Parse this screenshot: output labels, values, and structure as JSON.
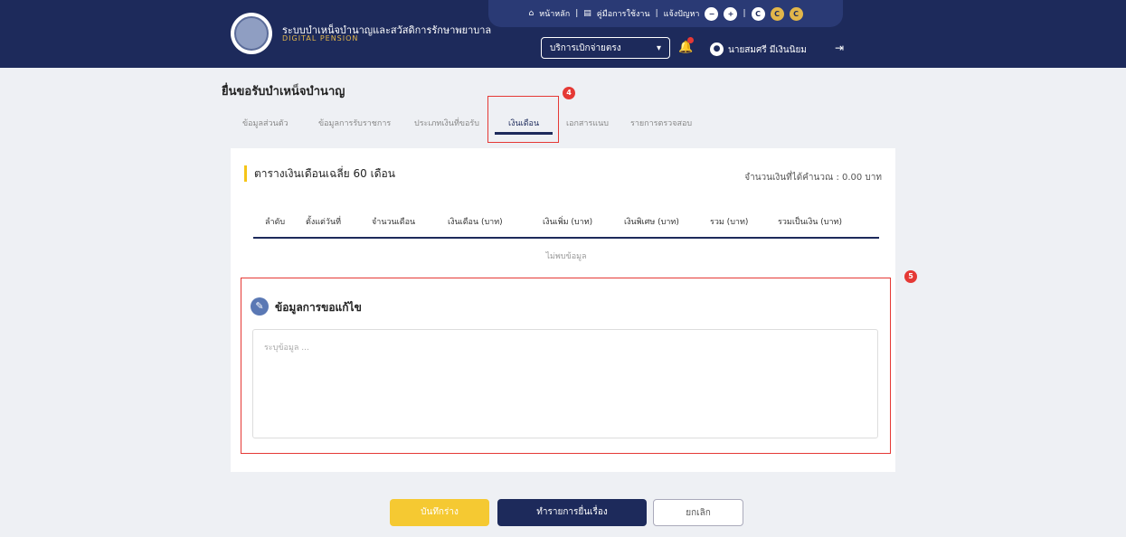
{
  "header": {
    "system_title": "ระบบบำเหน็จบำนาญและสวัสดิการรักษาพยาบาล",
    "system_subtitle": "DIGITAL PENSION",
    "top_links": {
      "home": "หน้าหลัก",
      "manual": "คู่มือการใช้งาน",
      "contact": "แจ้งปัญหา"
    },
    "role_select": "บริการเบิกจ่ายตรง",
    "user_name": "นายสมศรี มีเงินนิยม"
  },
  "page": {
    "title": "ยื่นขอรับบำเหน็จบำนาญ",
    "tabs": [
      {
        "label": "ข้อมูลส่วนตัว"
      },
      {
        "label": "ข้อมูลการรับราชการ"
      },
      {
        "label": "ประเภทเงินที่ขอรับ"
      },
      {
        "label": "เงินเดือน",
        "active": true
      },
      {
        "label": "เอกสารแนบ"
      },
      {
        "label": "รายการตรวจสอบ"
      }
    ],
    "badges": {
      "tab_marker": "4",
      "note_marker": "5"
    }
  },
  "salary_card": {
    "title": "ตารางเงินเดือนเฉลี่ย 60 เดือน",
    "total_label": "จำนวนเงินที่ได้คำนวณ : 0.00 บาท",
    "columns": [
      "ลำดับ",
      "ตั้งแต่วันที่",
      "จำนวนเดือน",
      "เงินเดือน (บาท)",
      "เงินเพิ่ม (บาท)",
      "เงินพิเศษ (บาท)",
      "รวม (บาท)",
      "รวมเป็นเงิน (บาท)"
    ],
    "empty_text": "ไม่พบข้อมูล"
  },
  "note": {
    "title": "ข้อมูลการขอแก้ไข",
    "placeholder": "ระบุข้อมูล ...",
    "value": ""
  },
  "buttons": {
    "save": "บันทึกร่าง",
    "submit": "ทำรายการยื่นเรื่อง",
    "cancel": "ยกเลิก"
  },
  "colors": {
    "header_bg": "#1d2a5b",
    "accent_yellow": "#f5c932",
    "highlight_red": "#e53935"
  }
}
